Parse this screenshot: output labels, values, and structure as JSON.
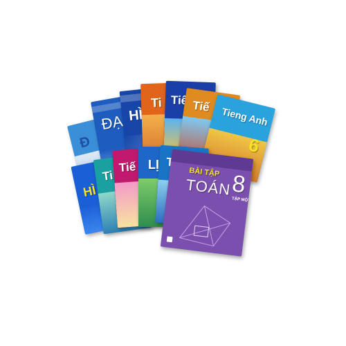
{
  "books_back": [
    {
      "title": "Đ",
      "color": "#3b8fd8",
      "accent": "#dfe9f5"
    },
    {
      "title": "ĐẠ",
      "color": "#1e5cc0",
      "accent": "#7fb0ef"
    },
    {
      "title": "HÌ",
      "color": "#1647a8",
      "accent": "#6a97e0"
    },
    {
      "title": "Ti",
      "color": "#e0641a",
      "accent": "#f4b04b"
    },
    {
      "title": "Tiế",
      "color": "#1a3fa6",
      "accent": "#5ab3f0"
    },
    {
      "title": "Tiế",
      "color": "#e08b1f",
      "accent": "#7ec8f3"
    },
    {
      "title": "Tieng Anh",
      "number": "6",
      "color": "#2aa3dc",
      "accent": "#f0c646"
    }
  ],
  "books_front": [
    {
      "title": "HÌ",
      "color": "#1b5fd6",
      "accent": "#3b86ef"
    },
    {
      "title": "Ti",
      "color": "#1aa0a0",
      "accent": "#8ed8c8"
    },
    {
      "title": "Tiế",
      "color": "#c0196e",
      "accent": "#f49ac8"
    },
    {
      "title": "LỊ",
      "color": "#1e66c8",
      "accent": "#7ecb6b"
    },
    {
      "title": "Tiế",
      "color": "#1a74c6",
      "accent": "#8fd0f0"
    }
  ],
  "front_book": {
    "header": "BÀI TẬP",
    "title": "TOÁN",
    "number": "8",
    "subtitle": "TẬP MỘT",
    "color": "#7a4fae",
    "accent": "#c6a6e8"
  }
}
